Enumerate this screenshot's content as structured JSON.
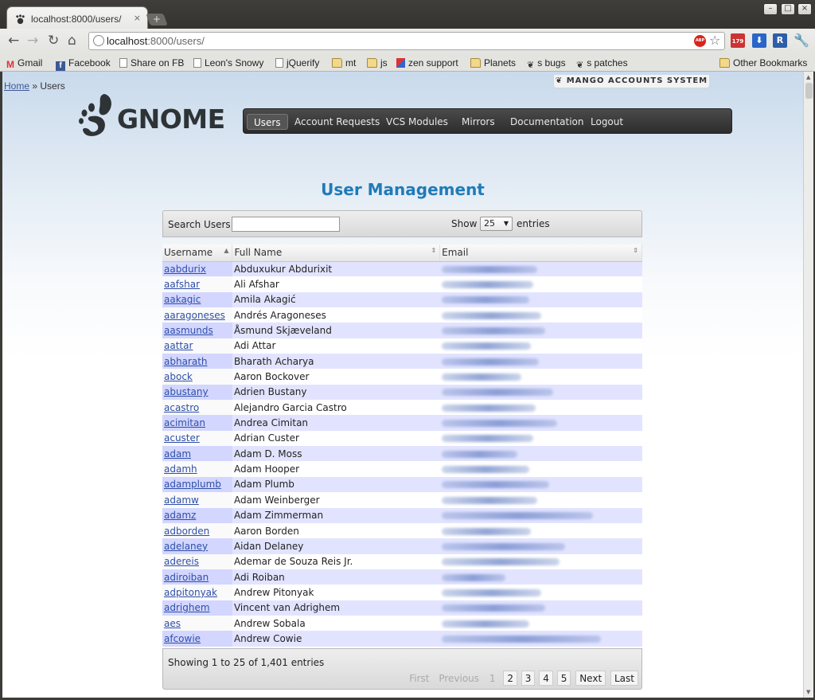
{
  "browser": {
    "tab_title": "localhost:8000/users/",
    "tab_close": "×",
    "new_tab": "+",
    "url_host": "localhost",
    "url_rest": ":8000/users/",
    "ext_gmail_count": "179",
    "ext_r_label": "R",
    "bookmarks_more": "»",
    "icons": [
      "back-icon",
      "forward-icon",
      "reload-icon",
      "home-icon",
      "star-icon",
      "wrench-icon"
    ],
    "bookmarks": [
      {
        "label": "Gmail",
        "icon": "gmail-icon"
      },
      {
        "label": "Facebook",
        "icon": "facebook-icon"
      },
      {
        "label": "Share on FB",
        "icon": "page-icon"
      },
      {
        "label": "Leon's Snowy",
        "icon": "page-icon"
      },
      {
        "label": "jQuerify",
        "icon": "page-icon"
      },
      {
        "label": "mt",
        "icon": "folder-icon"
      },
      {
        "label": "js",
        "icon": "folder-icon"
      },
      {
        "label": "zen support",
        "icon": "cube-icon"
      },
      {
        "label": "Planets",
        "icon": "folder-icon"
      },
      {
        "label": "s bugs",
        "icon": "gnome-foot-icon"
      },
      {
        "label": "s patches",
        "icon": "gnome-foot-icon"
      }
    ],
    "other_bookmarks": "Other Bookmarks"
  },
  "breadcrumb": {
    "home": "Home",
    "separator": " » ",
    "current": "Users"
  },
  "badge": "MANGO ACCOUNTS SYSTEM",
  "logo_text": "GNOME",
  "nav": [
    "Users",
    "Account Requests",
    "VCS Modules",
    "Mirrors",
    "Documentation",
    "Logout"
  ],
  "nav_active": "Users",
  "title": "User Management",
  "search": {
    "label": "Search Users",
    "value": ""
  },
  "length": {
    "show": "Show",
    "value": "25",
    "entries": "entries"
  },
  "columns": [
    "Username",
    "Full Name",
    "Email"
  ],
  "users": [
    {
      "username": "aabdurix",
      "name": "Abduxukur Abdurixit"
    },
    {
      "username": "aafshar",
      "name": "Ali Afshar"
    },
    {
      "username": "aakagic",
      "name": "Amila Akagić"
    },
    {
      "username": "aaragoneses",
      "name": "Andrés Aragoneses"
    },
    {
      "username": "aasmunds",
      "name": "Åsmund Skjæveland"
    },
    {
      "username": "aattar",
      "name": "Adi Attar"
    },
    {
      "username": "abharath",
      "name": "Bharath Acharya"
    },
    {
      "username": "abock",
      "name": "Aaron Bockover"
    },
    {
      "username": "abustany",
      "name": "Adrien Bustany"
    },
    {
      "username": "acastro",
      "name": "Alejandro Garcia Castro"
    },
    {
      "username": "acimitan",
      "name": "Andrea Cimitan"
    },
    {
      "username": "acuster",
      "name": "Adrian Custer"
    },
    {
      "username": "adam",
      "name": "Adam D. Moss"
    },
    {
      "username": "adamh",
      "name": "Adam Hooper"
    },
    {
      "username": "adamplumb",
      "name": "Adam Plumb"
    },
    {
      "username": "adamw",
      "name": "Adam Weinberger"
    },
    {
      "username": "adamz",
      "name": "Adam Zimmerman"
    },
    {
      "username": "adborden",
      "name": "Aaron Borden"
    },
    {
      "username": "adelaney",
      "name": "Aidan Delaney"
    },
    {
      "username": "adereis",
      "name": "Ademar de Souza Reis Jr."
    },
    {
      "username": "adiroiban",
      "name": "Adi Roiban"
    },
    {
      "username": "adpitonyak",
      "name": "Andrew Pitonyak"
    },
    {
      "username": "adrighem",
      "name": "Vincent van Adrighem"
    },
    {
      "username": "aes",
      "name": "Andrew Sobala"
    },
    {
      "username": "afcowie",
      "name": "Andrew Cowie"
    }
  ],
  "info": "Showing 1 to 25 of 1,401 entries",
  "pager": {
    "first": "First",
    "previous": "Previous",
    "pages": [
      "1",
      "2",
      "3",
      "4",
      "5"
    ],
    "current": "1",
    "next": "Next",
    "last": "Last"
  }
}
